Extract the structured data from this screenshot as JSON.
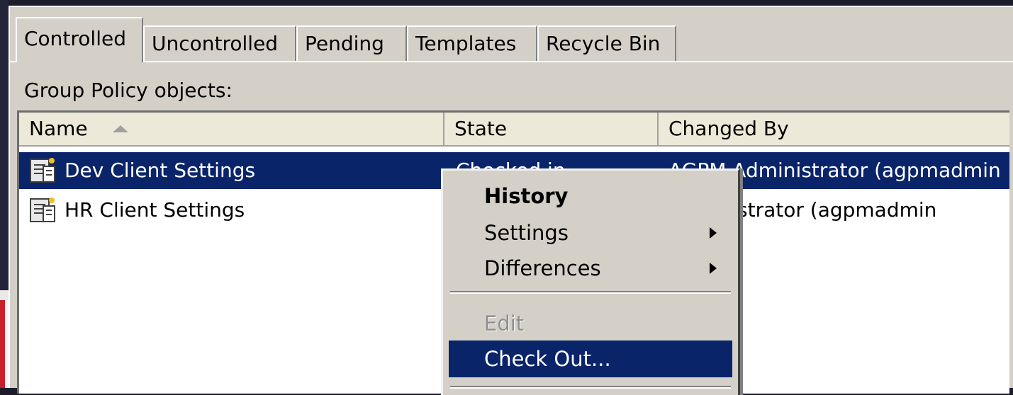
{
  "tabs": [
    "Controlled",
    "Uncontrolled",
    "Pending",
    "Templates",
    "Recycle Bin"
  ],
  "group_policy_label": "Group Policy objects:",
  "columns": {
    "name": "Name",
    "state": "State",
    "changed_by": "Changed By"
  },
  "rows": [
    {
      "name": "Dev Client Settings",
      "state": "Checked in",
      "changed_by": "AGPM Administrator (agpmadmin"
    },
    {
      "name": "HR Client Settings",
      "state": "",
      "changed_by": "Administrator (agpmadmin"
    }
  ],
  "context_menu": {
    "history": "History",
    "settings": "Settings",
    "differences": "Differences",
    "edit": "Edit",
    "check_out": "Check Out..."
  },
  "colors": {
    "selection": "#0a246a",
    "panel": "#d4d0c8"
  },
  "icons": [
    "gpo-icon",
    "sort-ascending-icon",
    "submenu-arrow-icon"
  ]
}
